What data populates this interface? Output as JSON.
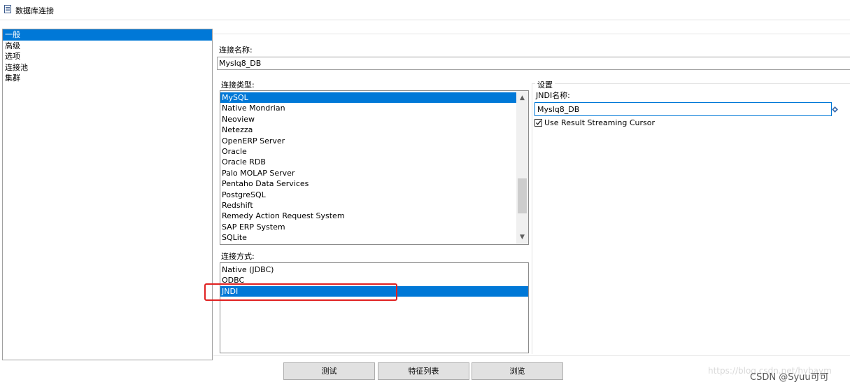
{
  "window": {
    "title": "数据库连接",
    "icon": "database-icon"
  },
  "nav": {
    "items": [
      {
        "label": "一般",
        "selected": true
      },
      {
        "label": "高级",
        "selected": false
      },
      {
        "label": "选项",
        "selected": false
      },
      {
        "label": "连接池",
        "selected": false
      },
      {
        "label": "集群",
        "selected": false
      }
    ]
  },
  "general": {
    "connection_name_label": "连接名称:",
    "connection_name_value": "Myslq8_DB",
    "connection_type_label": "连接类型:",
    "connection_types": [
      {
        "label": "MySQL",
        "selected": true
      },
      {
        "label": "Native Mondrian",
        "selected": false
      },
      {
        "label": "Neoview",
        "selected": false
      },
      {
        "label": "Netezza",
        "selected": false
      },
      {
        "label": "OpenERP Server",
        "selected": false
      },
      {
        "label": "Oracle",
        "selected": false
      },
      {
        "label": "Oracle RDB",
        "selected": false
      },
      {
        "label": "Palo MOLAP Server",
        "selected": false
      },
      {
        "label": "Pentaho Data Services",
        "selected": false
      },
      {
        "label": "PostgreSQL",
        "selected": false
      },
      {
        "label": "Redshift",
        "selected": false
      },
      {
        "label": "Remedy Action Request System",
        "selected": false
      },
      {
        "label": "SAP ERP System",
        "selected": false
      },
      {
        "label": "SQLite",
        "selected": false
      }
    ],
    "access_label": "连接方式:",
    "access_methods": [
      {
        "label": "Native (JDBC)",
        "selected": false
      },
      {
        "label": "ODBC",
        "selected": false
      },
      {
        "label": "JNDI",
        "selected": true
      }
    ]
  },
  "settings": {
    "group_label": "设置",
    "jndi_name_label": "JNDI名称:",
    "jndi_name_value": "Myslq8_DB",
    "use_streaming_cursor_label": "Use Result Streaming Cursor",
    "use_streaming_cursor_checked": true
  },
  "buttons": {
    "test": "测试",
    "features": "特征列表",
    "explore": "浏览"
  },
  "watermark": {
    "url": "https://blog.csdn.net/hybaym",
    "author": "CSDN @Syuu可可"
  },
  "colors": {
    "selection": "#0078d7",
    "highlight_box": "#e02020"
  }
}
